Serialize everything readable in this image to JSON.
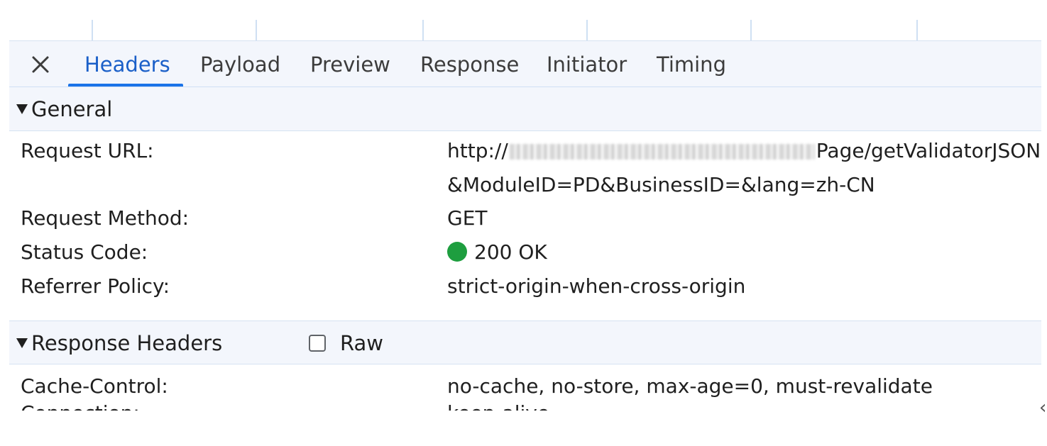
{
  "tabs": [
    {
      "label": "Headers",
      "active": true
    },
    {
      "label": "Payload"
    },
    {
      "label": "Preview"
    },
    {
      "label": "Response"
    },
    {
      "label": "Initiator"
    },
    {
      "label": "Timing"
    }
  ],
  "close_icon": "close-icon",
  "general": {
    "title": "General",
    "request_url_label": "Request URL:",
    "request_url_prefix": "http://",
    "request_url_suffix": "Page/getValidatorJSON",
    "request_url_line2": "&ModuleID=PD&BusinessID=&lang=zh-CN",
    "request_method_label": "Request Method:",
    "request_method_value": "GET",
    "status_code_label": "Status Code:",
    "status_code_value": "200 OK",
    "status_color": "#1e9e3f",
    "referrer_policy_label": "Referrer Policy:",
    "referrer_policy_value": "strict-origin-when-cross-origin"
  },
  "response_headers": {
    "title": "Response Headers",
    "raw_label": "Raw",
    "raw_checked": false,
    "cache_control_label": "Cache-Control:",
    "cache_control_value": "no-cache, no-store, max-age=0, must-revalidate",
    "connection_label": "Connection:",
    "connection_value": "keep-alive"
  },
  "colors": {
    "accent": "#1a73e8",
    "header_bg": "#f3f6fc"
  }
}
